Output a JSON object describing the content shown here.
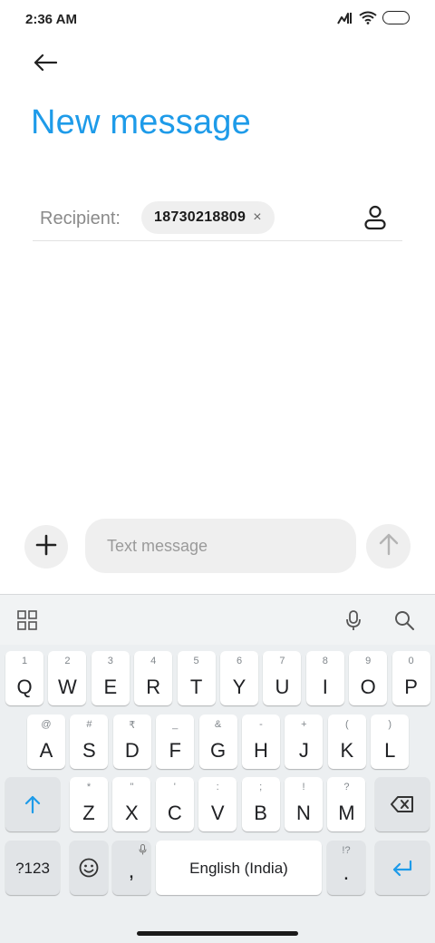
{
  "status_bar": {
    "time": "2:36 AM"
  },
  "header": {
    "title": "New message"
  },
  "recipient": {
    "label": "Recipient:",
    "chip_text": "18730218809",
    "chip_close": "×"
  },
  "composer": {
    "placeholder": "Text message"
  },
  "keyboard": {
    "row1": [
      {
        "hint": "1",
        "char": "Q"
      },
      {
        "hint": "2",
        "char": "W"
      },
      {
        "hint": "3",
        "char": "E"
      },
      {
        "hint": "4",
        "char": "R"
      },
      {
        "hint": "5",
        "char": "T"
      },
      {
        "hint": "6",
        "char": "Y"
      },
      {
        "hint": "7",
        "char": "U"
      },
      {
        "hint": "8",
        "char": "I"
      },
      {
        "hint": "9",
        "char": "O"
      },
      {
        "hint": "0",
        "char": "P"
      }
    ],
    "row2": [
      {
        "hint": "@",
        "char": "A"
      },
      {
        "hint": "#",
        "char": "S"
      },
      {
        "hint": "₹",
        "char": "D"
      },
      {
        "hint": "_",
        "char": "F"
      },
      {
        "hint": "&",
        "char": "G"
      },
      {
        "hint": "-",
        "char": "H"
      },
      {
        "hint": "+",
        "char": "J"
      },
      {
        "hint": "(",
        "char": "K"
      },
      {
        "hint": ")",
        "char": "L"
      }
    ],
    "row3": [
      {
        "hint": "*",
        "char": "Z"
      },
      {
        "hint": "\"",
        "char": "X"
      },
      {
        "hint": "'",
        "char": "C"
      },
      {
        "hint": ":",
        "char": "V"
      },
      {
        "hint": ";",
        "char": "B"
      },
      {
        "hint": "!",
        "char": "N"
      },
      {
        "hint": "?",
        "char": "M"
      }
    ],
    "symbols_label": "?123",
    "comma_label": ",",
    "space_label": "English (India)",
    "period_hint": "!?",
    "period_label": "."
  },
  "colors": {
    "accent": "#1e9be9"
  }
}
